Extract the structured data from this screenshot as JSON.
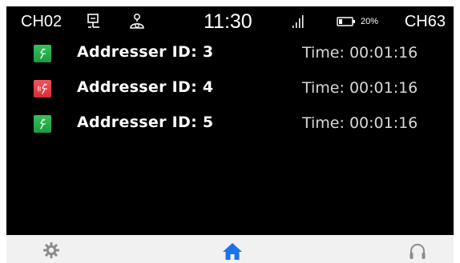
{
  "status_bar": {
    "channel_left": "CH02",
    "channel_right": "CH63",
    "time": "11:30",
    "battery_percent": "20%",
    "icons": [
      "network-icon",
      "mic-icon",
      "signal-icon",
      "battery-icon"
    ]
  },
  "calls": [
    {
      "address": "Addresser ID: 3",
      "time": "Time: 00:01:16",
      "status": "green",
      "icon": "call-icon"
    },
    {
      "address": "Addresser ID: 4",
      "time": "Time: 00:01:16",
      "status": "red",
      "icon": "ringing-call-icon"
    },
    {
      "address": "Addresser ID: 5",
      "time": "Time: 00:01:16",
      "status": "green",
      "icon": "call-icon"
    }
  ],
  "bottom_nav": {
    "items": [
      "settings-icon",
      "home-icon",
      "headset-icon"
    ],
    "active": "home-icon"
  },
  "colors": {
    "active_nav": "#1a73e8",
    "inactive_nav": "#8c8c8c",
    "call_green": "#2bb24c",
    "call_red": "#e53a40"
  }
}
